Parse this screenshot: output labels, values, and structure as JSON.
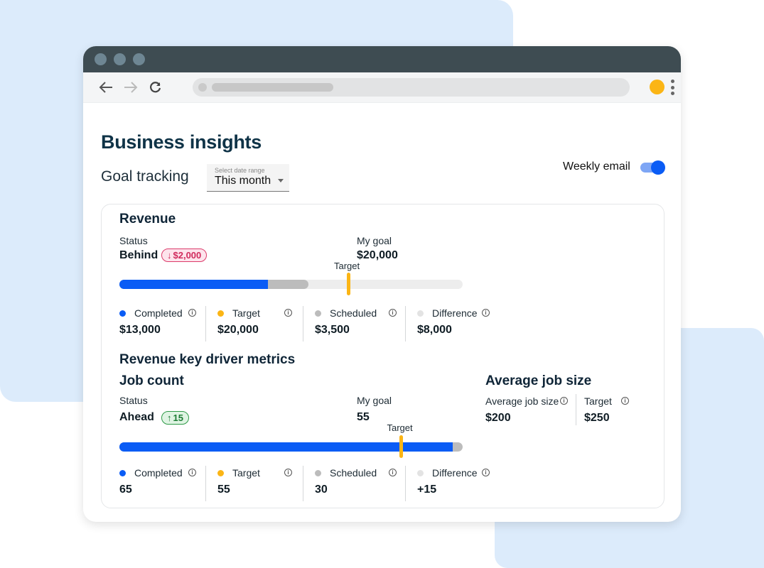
{
  "browser": {
    "back_icon": "arrow-left-icon",
    "forward_icon": "arrow-right-icon",
    "reload_icon": "reload-icon",
    "menu_icon": "kebab-menu-icon"
  },
  "header": {
    "title": "Business insights",
    "subtitle": "Goal tracking",
    "date_range": {
      "label": "Select date range",
      "value": "This month"
    },
    "weekly_email": {
      "label": "Weekly email",
      "enabled": true
    }
  },
  "colors": {
    "completed": "#0a5cf5",
    "target": "#fbb515",
    "scheduled": "#bcbcbc",
    "difference": "#e3e3e3",
    "behind": "#d02a5c",
    "ahead": "#1d7c35"
  },
  "revenue": {
    "title": "Revenue",
    "status_label": "Status",
    "status": "Behind",
    "delta_badge": "$2,000",
    "goal_label": "My goal",
    "goal": "$20,000",
    "target_label": "Target",
    "progress": {
      "completed": 13000,
      "scheduled": 3500,
      "target": 20000,
      "max": 30000
    },
    "stats": [
      {
        "label": "Completed",
        "value": "$13,000"
      },
      {
        "label": "Target",
        "value": "$20,000"
      },
      {
        "label": "Scheduled",
        "value": "$3,500"
      },
      {
        "label": "Difference",
        "value": "$8,000"
      }
    ]
  },
  "drivers": {
    "title": "Revenue key driver metrics",
    "job_count": {
      "title": "Job count",
      "status_label": "Status",
      "status": "Ahead",
      "delta_badge": "15",
      "goal_label": "My goal",
      "goal": "55",
      "target_label": "Target",
      "progress": {
        "completed": 65,
        "scheduled": 2,
        "target": 55,
        "max": 67
      },
      "stats": [
        {
          "label": "Completed",
          "value": "65"
        },
        {
          "label": "Target",
          "value": "55"
        },
        {
          "label": "Scheduled",
          "value": "30"
        },
        {
          "label": "Difference",
          "value": "+15"
        }
      ]
    },
    "avg_job_size": {
      "title": "Average job size",
      "stats": [
        {
          "label": "Average job size",
          "value": "$200"
        },
        {
          "label": "Target",
          "value": "$250"
        }
      ]
    }
  }
}
